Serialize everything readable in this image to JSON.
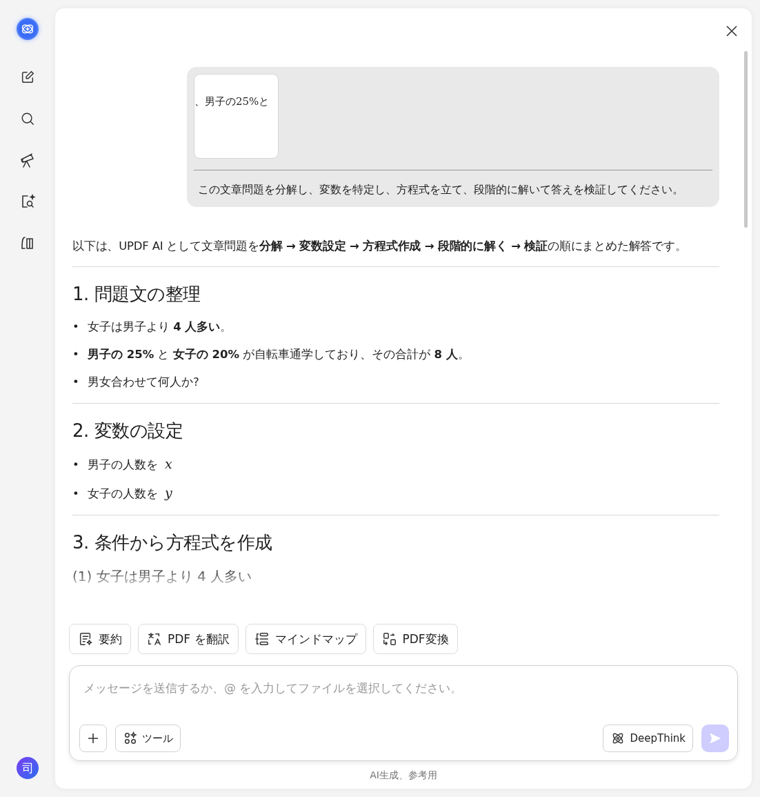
{
  "sidebar": {
    "avatar_letter": "司"
  },
  "user_message": {
    "attachment_preview_text": "、男子の25%と",
    "prompt": "この文章問題を分解し、変数を特定し、方程式を立て、段階的に解いて答えを検証してください。"
  },
  "answer": {
    "intro": "以下は、UPDF AI として文章問題を**分解 → 変数設定 → 方程式作成 → 段階的に解く → 検証**の順にまとめた解答です。",
    "sections": [
      {
        "heading": "1. 問題文の整理",
        "items": [
          {
            "marker": "•",
            "text": "女子は男子より **4 人多い**。"
          },
          {
            "marker": "•",
            "text": "**男子の 25%** と **女子の 20%** が自転車通学しており、その合計が **8 人**。"
          },
          {
            "marker": "•",
            "text": "男女合わせて何人か?"
          }
        ]
      },
      {
        "heading": "2. 変数の設定",
        "items": [
          {
            "marker": "•",
            "text": "男子の人数を",
            "variable": "x"
          },
          {
            "marker": "•",
            "text": "女子の人数を",
            "variable": "y"
          }
        ]
      },
      {
        "heading": "3. 条件から方程式を作成"
      }
    ],
    "faded_line": "(1) 女子は男子より 4 人多い"
  },
  "quick_actions": [
    {
      "kind": "summary",
      "label": "要約"
    },
    {
      "kind": "translate",
      "label": "PDF を翻訳"
    },
    {
      "kind": "mindmap",
      "label": "マインドマップ"
    },
    {
      "kind": "convert",
      "label": "PDF変換"
    }
  ],
  "composer": {
    "placeholder": "メッセージを送信するか、@ を入力してファイルを選択してください。",
    "tools_label": "ツール",
    "deepthink_label": "DeepThink",
    "send_disabled": true
  },
  "footer": "AI生成、参考用"
}
